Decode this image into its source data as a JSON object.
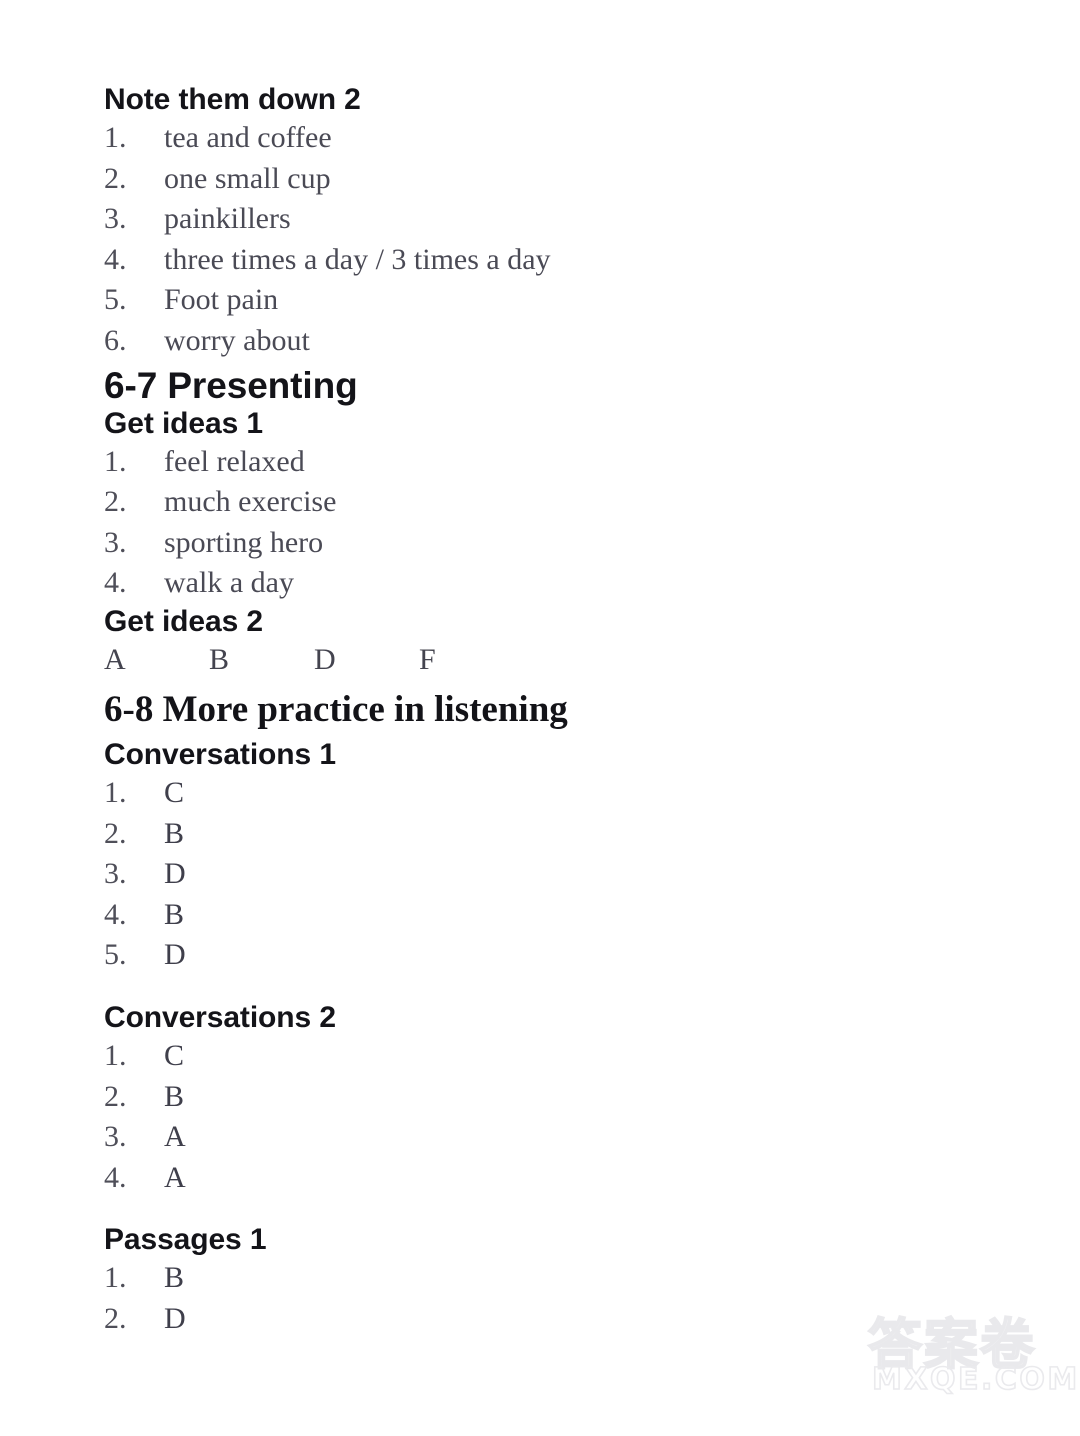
{
  "page": {
    "background_color": "#ffffff",
    "text_color": "#1b1b1f",
    "faded_text_color": "#4a4a55"
  },
  "sections": [
    {
      "id": "note-them-down-2",
      "heading": "Note them down 2",
      "heading_style": "sans-bold",
      "items": [
        {
          "num": "1.",
          "answer": "tea and coffee"
        },
        {
          "num": "2.",
          "answer": "one small cup"
        },
        {
          "num": "3.",
          "answer": "painkillers"
        },
        {
          "num": "4.",
          "answer": "three times a day / 3 times a day"
        },
        {
          "num": "5.",
          "answer": "Foot pain"
        },
        {
          "num": "6.",
          "answer": "worry about"
        }
      ]
    },
    {
      "id": "6-7-presenting",
      "heading": "6-7 Presenting",
      "heading_style": "sans-bold-large"
    },
    {
      "id": "get-ideas-1",
      "heading": "Get ideas 1",
      "heading_style": "sans-bold",
      "items": [
        {
          "num": "1.",
          "answer": "feel relaxed"
        },
        {
          "num": "2.",
          "answer": "much exercise"
        },
        {
          "num": "3.",
          "answer": "sporting hero"
        },
        {
          "num": "4.",
          "answer": "walk a day"
        }
      ]
    },
    {
      "id": "get-ideas-2",
      "heading": "Get ideas 2",
      "heading_style": "sans-bold",
      "letters": [
        "A",
        "B",
        "D",
        "F"
      ]
    },
    {
      "id": "6-8-more-practice-in-listening",
      "heading": "6-8 More practice in listening",
      "heading_style": "serif-bold-large"
    },
    {
      "id": "conversations-1",
      "heading": "Conversations 1",
      "heading_style": "sans-bold",
      "items": [
        {
          "num": "1.",
          "answer": "C"
        },
        {
          "num": "2.",
          "answer": "B"
        },
        {
          "num": "3.",
          "answer": "D"
        },
        {
          "num": "4.",
          "answer": "B"
        },
        {
          "num": "5.",
          "answer": "D"
        }
      ]
    },
    {
      "id": "conversations-2",
      "heading": "Conversations 2",
      "heading_style": "sans-bold",
      "items": [
        {
          "num": "1.",
          "answer": "C"
        },
        {
          "num": "2.",
          "answer": "B"
        },
        {
          "num": "3.",
          "answer": "A"
        },
        {
          "num": "4.",
          "answer": "A"
        }
      ]
    },
    {
      "id": "passages-1",
      "heading": "Passages 1",
      "heading_style": "sans-bold",
      "items": [
        {
          "num": "1.",
          "answer": "B"
        },
        {
          "num": "2.",
          "answer": "D"
        }
      ]
    }
  ],
  "watermark": {
    "cjk": "答案卷",
    "domain": "MXQE.COM",
    "color": "#eaeaed"
  }
}
